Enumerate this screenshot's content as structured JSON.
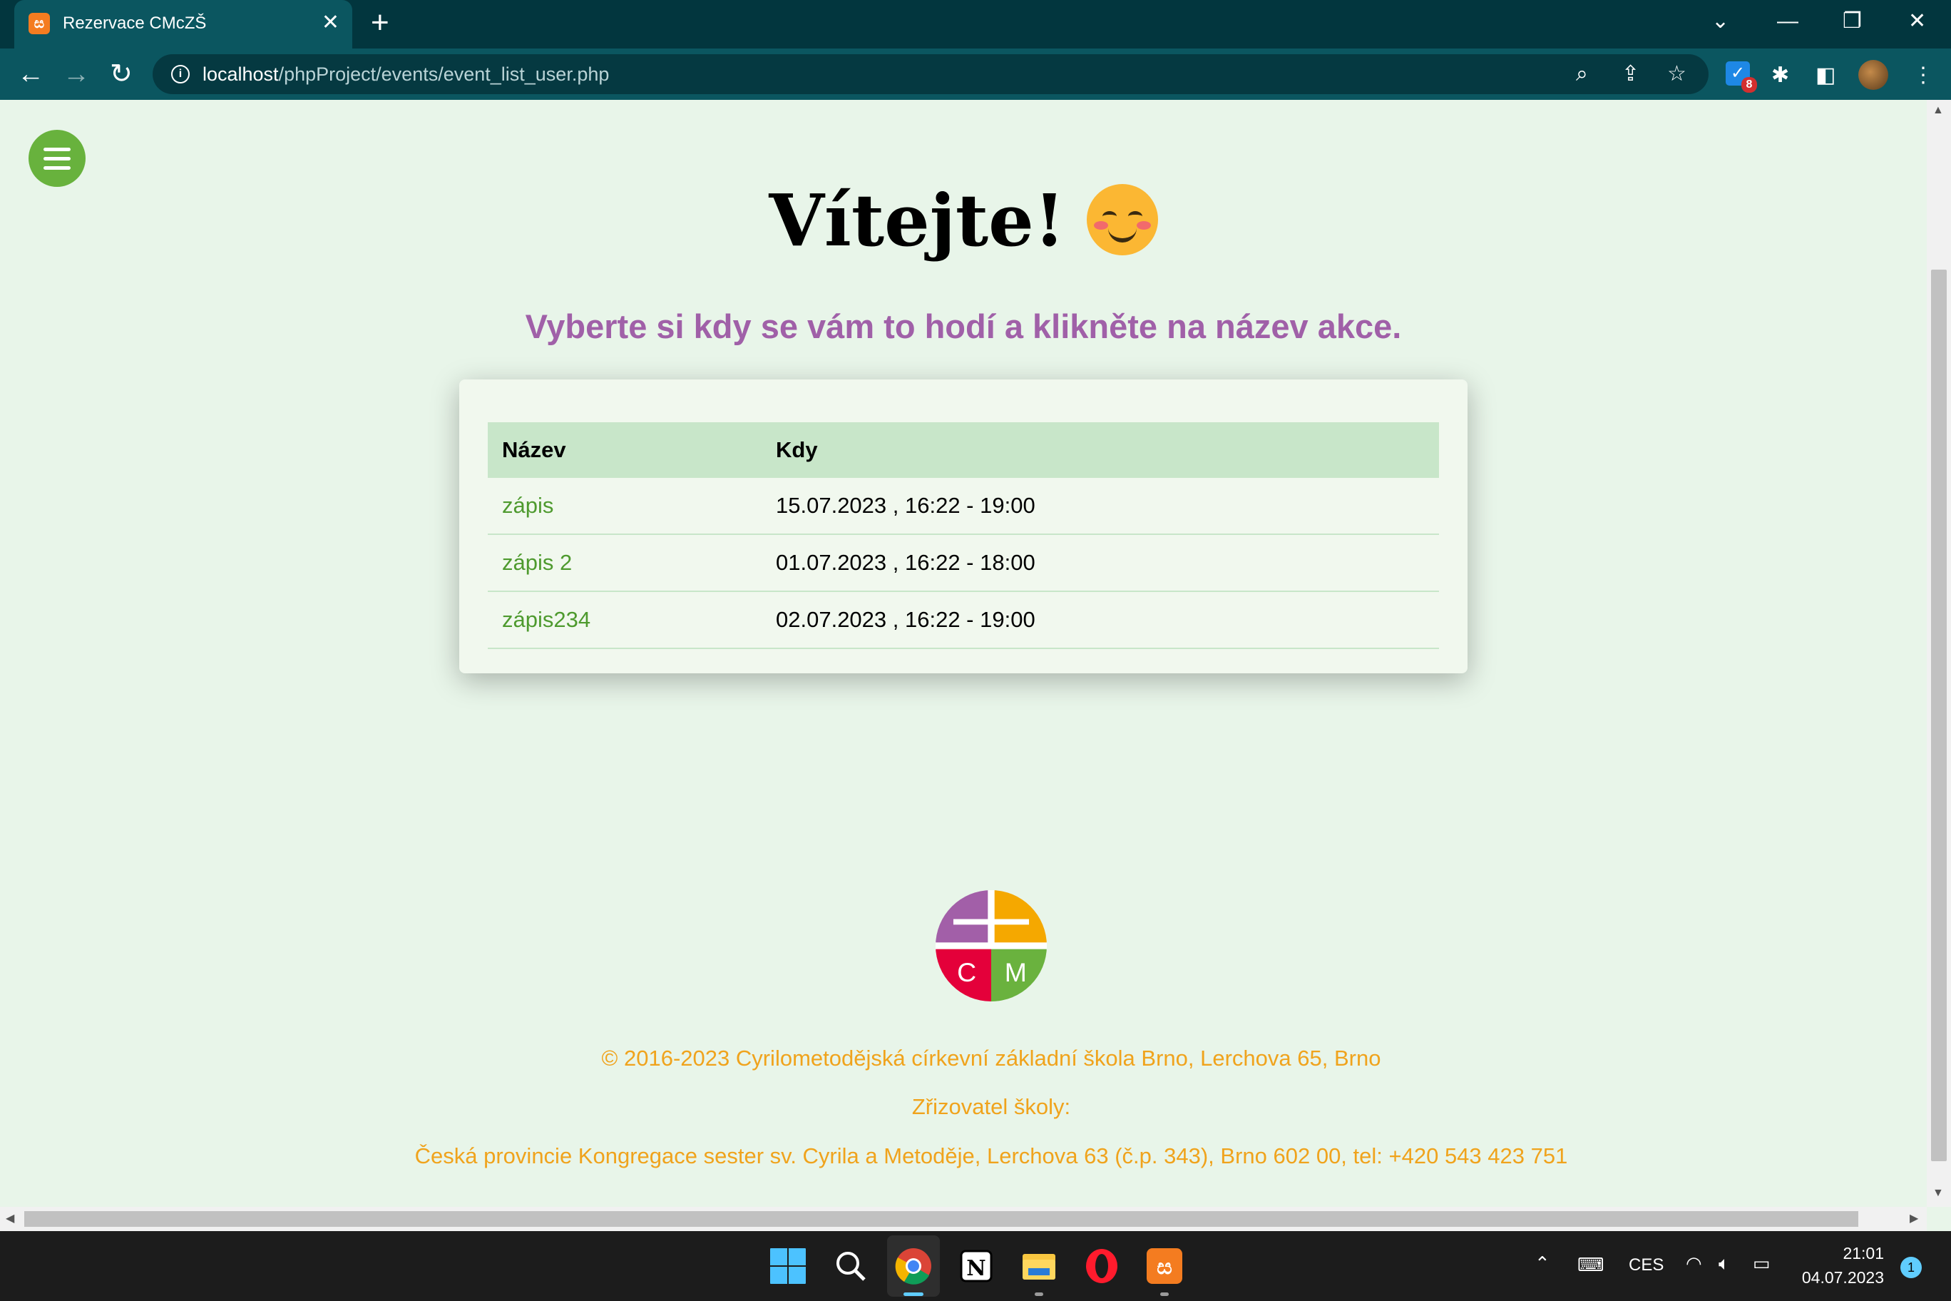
{
  "browser": {
    "tab_title": "Rezervace CMcZŠ",
    "url_host": "localhost",
    "url_path": "/phpProject/events/event_list_user.php",
    "extension_badge_count": "8"
  },
  "page": {
    "welcome": "Vítejte!",
    "subtitle": "Vyberte si kdy se vám to hodí a klikněte na název akce.",
    "table": {
      "headers": [
        "Název",
        "Kdy"
      ],
      "rows": [
        {
          "name": "zápis",
          "when": "15.07.2023 , 16:22 - 19:00"
        },
        {
          "name": "zápis 2",
          "when": "01.07.2023 , 16:22 - 18:00"
        },
        {
          "name": "zápis234",
          "when": "02.07.2023 , 16:22 - 19:00"
        }
      ]
    },
    "logo_letters": [
      "C",
      "M"
    ],
    "footer": {
      "copyright": "© 2016-2023 Cyrilometodějská církevní základní škola Brno, Lerchova 65, Brno",
      "founder_label": "Zřizovatel školy:",
      "founder": "Česká provincie Kongregace sester sv. Cyrila a Metoděje, Lerchova 63 (č.p. 343), Brno 602 00, tel: +420 543 423 751"
    }
  },
  "taskbar": {
    "language": "CES",
    "time": "21:01",
    "date": "04.07.2023",
    "notifications": "1"
  },
  "colors": {
    "page_bg": "#e8f5e9",
    "accent_green": "#68b23d",
    "subtitle_purple": "#a060a8",
    "footer_orange": "#f0a31c",
    "table_header": "#c8e6c9"
  }
}
